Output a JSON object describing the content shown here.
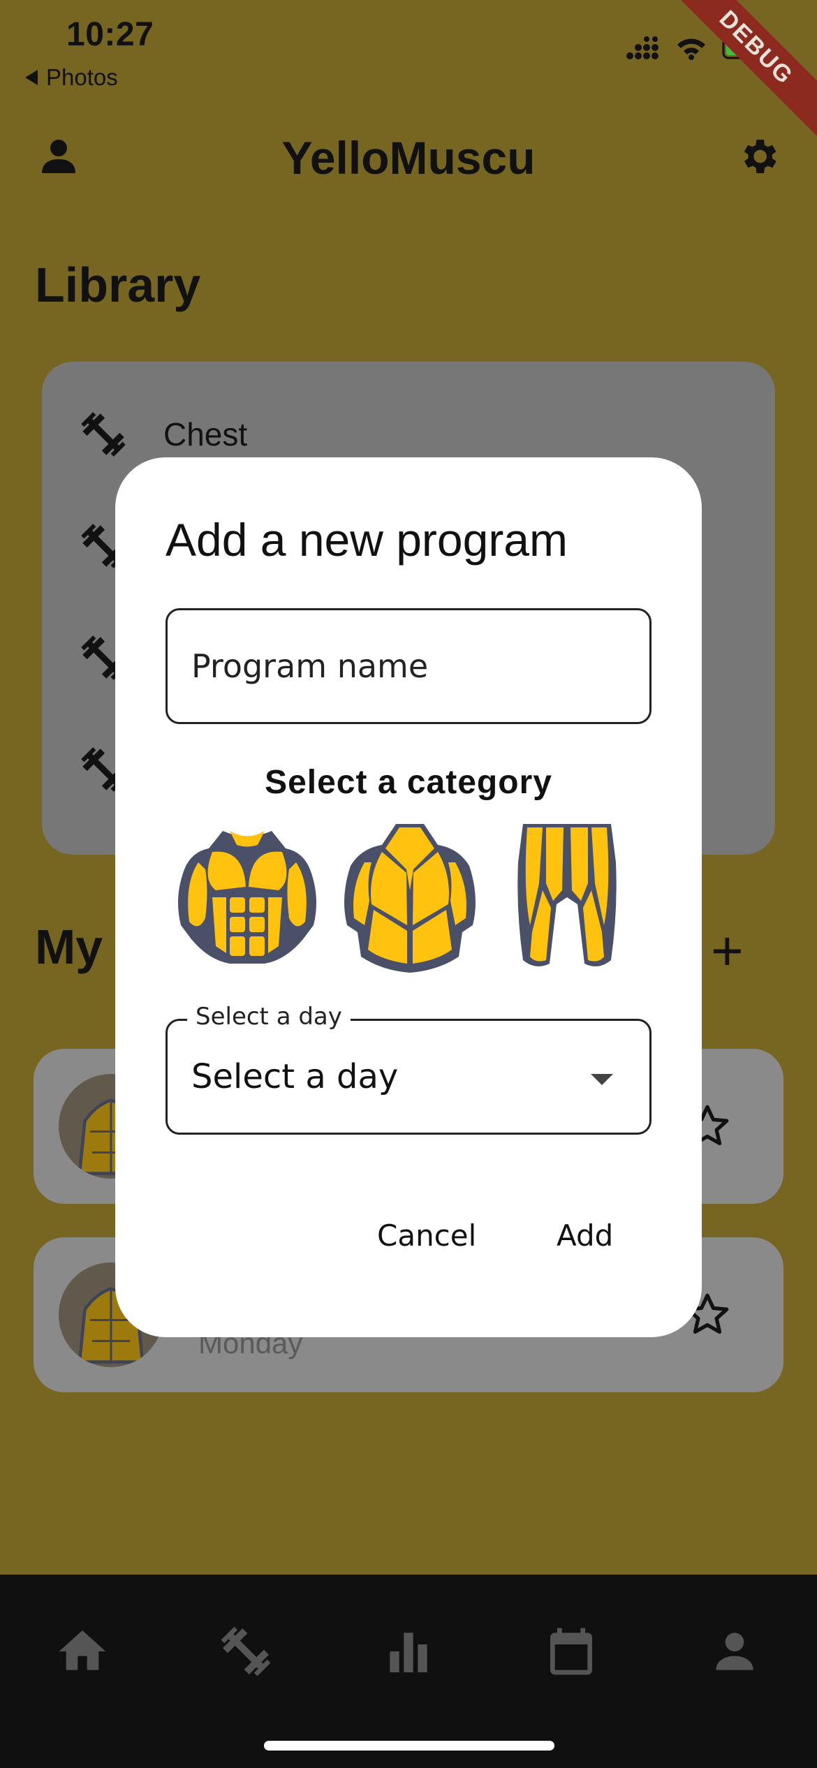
{
  "status_bar": {
    "time": "10:27",
    "back_label": "Photos",
    "debug_label": "DEBUG"
  },
  "appbar": {
    "title": "YelloMuscu"
  },
  "library": {
    "title": "Library",
    "items": [
      {
        "label": "Chest"
      }
    ]
  },
  "programs": {
    "title_fragment": "My",
    "add_label": "+",
    "cards": [
      {
        "subtitle": ""
      },
      {
        "subtitle": "Monday"
      }
    ]
  },
  "dialog": {
    "title": "Add a new program",
    "name_placeholder": "Program name",
    "category_label": "Select a category",
    "categories": [
      {
        "icon": "chest-muscle-icon"
      },
      {
        "icon": "back-muscle-icon"
      },
      {
        "icon": "legs-muscle-icon"
      }
    ],
    "day_legend": "Select a day",
    "day_value": "Select a day",
    "cancel_label": "Cancel",
    "add_label": "Add"
  },
  "colors": {
    "background": "#776621",
    "muscle_yellow": "#FFC20E",
    "muscle_outline": "#4A5068",
    "nav_bg": "#101010"
  },
  "bottom_nav": {
    "items": [
      "home-icon",
      "dumbbell-icon",
      "chart-icon",
      "calendar-icon",
      "person-icon"
    ]
  }
}
